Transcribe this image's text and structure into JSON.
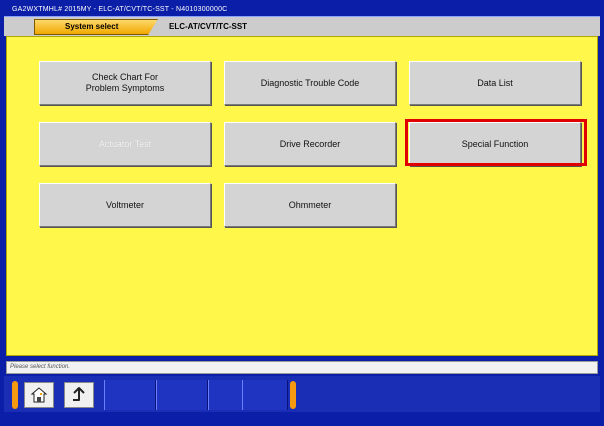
{
  "window": {
    "title": "GA2WXTMHL# 2015MY  -  ELC-AT/CVT/TC-SST  -  N4010300000C"
  },
  "tabs": [
    {
      "label": "System select"
    },
    {
      "label": "ELC-AT/CVT/TC-SST"
    }
  ],
  "buttons": {
    "check_chart": "Check Chart For\nProblem Symptoms",
    "dtc": "Diagnostic Trouble Code",
    "data_list": "Data List",
    "actuator_test": "Actuator Test",
    "drive_recorder": "Drive Recorder",
    "special_function": "Special Function",
    "voltmeter": "Voltmeter",
    "ohmmeter": "Ohmmeter"
  },
  "status": {
    "text": "Please select function."
  },
  "toolbar": {
    "home_icon": "home-icon",
    "back_icon": "up-arrow-icon"
  },
  "colors": {
    "frame_blue": "#0a1ea8",
    "content_yellow": "#fff84a",
    "highlight_red": "#e00000",
    "tab_orange": "#f0a800"
  }
}
